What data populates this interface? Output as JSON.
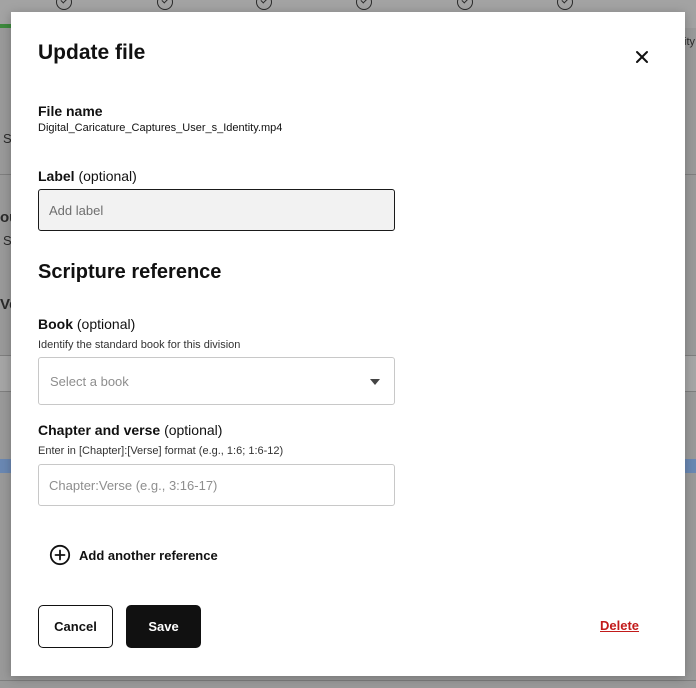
{
  "colors": {
    "overlay": "#9a9a9a",
    "modal_bg": "#ffffff",
    "primary": "#111111",
    "danger": "#c21a1a",
    "input_filled_bg": "#f2f2f2",
    "progress_green": "#3d8a3d"
  },
  "background": {
    "fragments": [
      "Se",
      "Se",
      "ou",
      "Ve",
      "ity"
    ]
  },
  "modal": {
    "title": "Update file",
    "close_icon": "close-icon",
    "file_name": {
      "label": "File name",
      "value": "Digital_Caricature_Captures_User_s_Identity.mp4"
    },
    "label_field": {
      "label": "Label",
      "optional": "(optional)",
      "placeholder": "Add label",
      "value": ""
    },
    "scripture": {
      "title": "Scripture reference",
      "book": {
        "label": "Book",
        "optional": "(optional)",
        "help": "Identify the standard book for this division",
        "placeholder": "Select a book",
        "selected": ""
      },
      "chapter": {
        "label": "Chapter and verse",
        "optional": "(optional)",
        "help": "Enter in [Chapter]:[Verse] format (e.g., 1:6; 1:6-12)",
        "placeholder": "Chapter:Verse (e.g., 3:16-17)",
        "value": ""
      },
      "add_reference": {
        "label": "Add another reference",
        "icon": "plus-circle-icon"
      }
    },
    "actions": {
      "cancel": "Cancel",
      "save": "Save",
      "delete": "Delete"
    }
  }
}
